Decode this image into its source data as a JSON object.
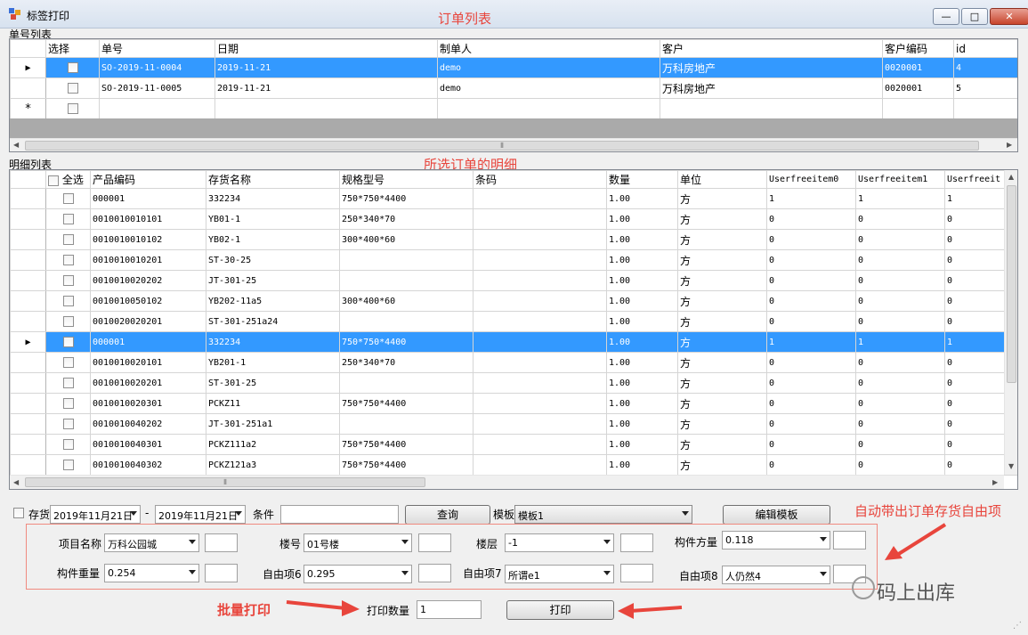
{
  "window": {
    "title": "标签打印",
    "minimize_glyph": "—",
    "maximize_glyph": "□",
    "close_glyph": "✕"
  },
  "annotations": {
    "order_list": "订单列表",
    "detail": "所选订单的明细",
    "auto_items": "自动带出订单存货自由项",
    "batch_print": "批量打印",
    "watermark": "码上出库"
  },
  "orders": {
    "section_label": "单号列表",
    "columns": [
      "选择",
      "单号",
      "日期",
      "制单人",
      "客户",
      "客户编码",
      "id"
    ],
    "rows": [
      {
        "indicator": "▶",
        "no": "SO-2019-11-0004",
        "date": "2019-11-21",
        "maker": "demo",
        "customer": "万科房地产",
        "customer_code": "0020001",
        "id": "4"
      },
      {
        "indicator": "",
        "no": "SO-2019-11-0005",
        "date": "2019-11-21",
        "maker": "demo",
        "customer": "万科房地产",
        "customer_code": "0020001",
        "id": "5"
      }
    ],
    "new_row_indicator": "*"
  },
  "details": {
    "section_label": "明细列表",
    "select_all": "全选",
    "columns": [
      "产品编码",
      "存货名称",
      "规格型号",
      "条码",
      "数量",
      "单位",
      "Userfreeitem0",
      "Userfreeitem1",
      "Userfreeit"
    ],
    "rows": [
      {
        "ind": "",
        "code": "000001",
        "name": "332234",
        "spec": "750*750*4400",
        "barcode": "",
        "qty": "1.00",
        "unit": "方",
        "f0": "1",
        "f1": "1",
        "f2": "1"
      },
      {
        "ind": "",
        "code": "0010010010101",
        "name": "YB01-1",
        "spec": "250*340*70",
        "barcode": "",
        "qty": "1.00",
        "unit": "方",
        "f0": "0",
        "f1": "0",
        "f2": "0"
      },
      {
        "ind": "",
        "code": "0010010010102",
        "name": "YB02-1",
        "spec": "300*400*60",
        "barcode": "",
        "qty": "1.00",
        "unit": "方",
        "f0": "0",
        "f1": "0",
        "f2": "0"
      },
      {
        "ind": "",
        "code": "0010010010201",
        "name": "ST-30-25",
        "spec": "",
        "barcode": "",
        "qty": "1.00",
        "unit": "方",
        "f0": "0",
        "f1": "0",
        "f2": "0"
      },
      {
        "ind": "",
        "code": "0010010020202",
        "name": "JT-301-25",
        "spec": "",
        "barcode": "",
        "qty": "1.00",
        "unit": "方",
        "f0": "0",
        "f1": "0",
        "f2": "0"
      },
      {
        "ind": "",
        "code": "0010010050102",
        "name": "YB202-11a5",
        "spec": "300*400*60",
        "barcode": "",
        "qty": "1.00",
        "unit": "方",
        "f0": "0",
        "f1": "0",
        "f2": "0"
      },
      {
        "ind": "",
        "code": "0010020020201",
        "name": "ST-301-251a24",
        "spec": "",
        "barcode": "",
        "qty": "1.00",
        "unit": "方",
        "f0": "0",
        "f1": "0",
        "f2": "0"
      },
      {
        "ind": "▶",
        "code": "000001",
        "name": "332234",
        "spec": "750*750*4400",
        "barcode": "",
        "qty": "1.00",
        "unit": "方",
        "f0": "1",
        "f1": "1",
        "f2": "1"
      },
      {
        "ind": "",
        "code": "0010010020101",
        "name": "YB201-1",
        "spec": "250*340*70",
        "barcode": "",
        "qty": "1.00",
        "unit": "方",
        "f0": "0",
        "f1": "0",
        "f2": "0"
      },
      {
        "ind": "",
        "code": "0010010020201",
        "name": "ST-301-25",
        "spec": "",
        "barcode": "",
        "qty": "1.00",
        "unit": "方",
        "f0": "0",
        "f1": "0",
        "f2": "0"
      },
      {
        "ind": "",
        "code": "0010010020301",
        "name": "PCKZ11",
        "spec": "750*750*4400",
        "barcode": "",
        "qty": "1.00",
        "unit": "方",
        "f0": "0",
        "f1": "0",
        "f2": "0"
      },
      {
        "ind": "",
        "code": "0010010040202",
        "name": "JT-301-251a1",
        "spec": "",
        "barcode": "",
        "qty": "1.00",
        "unit": "方",
        "f0": "0",
        "f1": "0",
        "f2": "0"
      },
      {
        "ind": "",
        "code": "0010010040301",
        "name": "PCKZ111a2",
        "spec": "750*750*4400",
        "barcode": "",
        "qty": "1.00",
        "unit": "方",
        "f0": "0",
        "f1": "0",
        "f2": "0"
      },
      {
        "ind": "",
        "code": "0010010040302",
        "name": "PCKZ121a3",
        "spec": "750*750*4400",
        "barcode": "",
        "qty": "1.00",
        "unit": "方",
        "f0": "0",
        "f1": "0",
        "f2": "0"
      }
    ]
  },
  "filter": {
    "stock_label": "存货",
    "date_from": "2019年11月21日",
    "date_sep": "-",
    "date_to": "2019年11月21日",
    "condition_label": "条件",
    "condition_value": "",
    "query_button": "查询",
    "template_label": "模板",
    "template_value": "模板1",
    "edit_template_button": "编辑模板"
  },
  "fields": {
    "project_name_label": "项目名称",
    "project_name_value": "万科公园城",
    "building_label": "楼号",
    "building_value": "01号楼",
    "floor_label": "楼层",
    "floor_value": "-1",
    "volume_label": "构件方量",
    "volume_value": "0.118",
    "weight_label": "构件重量",
    "weight_value": "0.254",
    "item6_label": "自由项6",
    "item6_value": "0.295",
    "item7_label": "自由项7",
    "item7_value": "所谓e1",
    "item8_label": "自由项8",
    "item8_value": "人仍然4"
  },
  "print": {
    "qty_label": "打印数量",
    "qty_value": "1",
    "print_button": "打印"
  },
  "colors": {
    "selection": "#3399ff",
    "annotation": "#e8453c"
  }
}
